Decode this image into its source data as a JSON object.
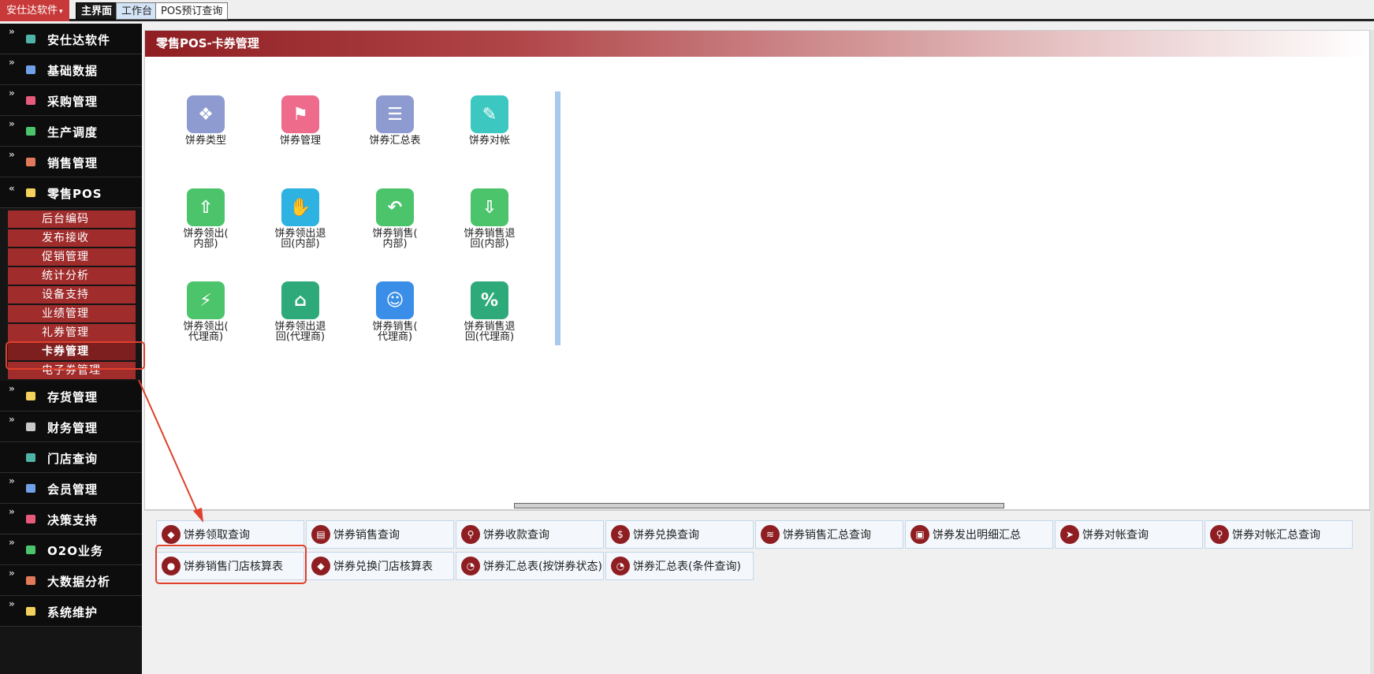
{
  "topbar": {
    "brand": "安仕达软件",
    "tabs": [
      "主界面",
      "工作台",
      "POS预订查询"
    ]
  },
  "sidebar": {
    "items_top": [
      {
        "label": "安仕达软件",
        "color": "#4fb3a8"
      },
      {
        "label": "基础数据",
        "color": "#6fa0e8"
      },
      {
        "label": "采购管理",
        "color": "#e85a7a"
      },
      {
        "label": "生产调度",
        "color": "#4cc46b"
      },
      {
        "label": "销售管理",
        "color": "#e07a5a"
      },
      {
        "label": "零售POS",
        "color": "#f2d25c"
      }
    ],
    "pos_sub": [
      "后台编码",
      "发布接收",
      "促销管理",
      "统计分析",
      "设备支持",
      "业绩管理",
      "礼券管理",
      "卡券管理",
      "电子券管理"
    ],
    "items_bottom": [
      {
        "label": "存货管理",
        "color": "#f2d25c"
      },
      {
        "label": "财务管理",
        "color": "#c9c9c9"
      },
      {
        "label": "门店查询",
        "color": "#4fb3a8"
      },
      {
        "label": "会员管理",
        "color": "#6fa0e8"
      },
      {
        "label": "决策支持",
        "color": "#e85a7a"
      },
      {
        "label": "O2O业务",
        "color": "#4cc46b"
      },
      {
        "label": "大数据分析",
        "color": "#e07a5a"
      },
      {
        "label": "系统维护",
        "color": "#f2d25c"
      }
    ]
  },
  "main": {
    "title": "零售POS-卡券管理",
    "icons": [
      {
        "l1": "饼券类型",
        "l2": "",
        "color": "#8e9bd0",
        "glyph": "❖"
      },
      {
        "l1": "饼券管理",
        "l2": "",
        "color": "#ee6b8c",
        "glyph": "⚑"
      },
      {
        "l1": "饼券汇总表",
        "l2": "",
        "color": "#8e9bd0",
        "glyph": "☰"
      },
      {
        "l1": "饼券对帐",
        "l2": "",
        "color": "#3cc8c0",
        "glyph": "✎"
      },
      {
        "l1": "饼券领出(",
        "l2": "内部)",
        "color": "#4cc46b",
        "glyph": "⇧"
      },
      {
        "l1": "饼券领出退",
        "l2": "回(内部)",
        "color": "#2eb2e2",
        "glyph": "✋"
      },
      {
        "l1": "饼券销售(",
        "l2": "内部)",
        "color": "#4cc46b",
        "glyph": "↶"
      },
      {
        "l1": "饼券销售退",
        "l2": "回(内部)",
        "color": "#4cc46b",
        "glyph": "⇩"
      },
      {
        "l1": "饼券领出(",
        "l2": "代理商)",
        "color": "#4cc46b",
        "glyph": "⚡"
      },
      {
        "l1": "饼券领出退",
        "l2": "回(代理商)",
        "color": "#2eaa7a",
        "glyph": "⌂"
      },
      {
        "l1": "饼券销售(",
        "l2": "代理商)",
        "color": "#3a8ee8",
        "glyph": "☺"
      },
      {
        "l1": "饼券销售退",
        "l2": "回(代理商)",
        "color": "#2eaa7a",
        "glyph": "%"
      }
    ]
  },
  "queries": [
    {
      "label": "饼券领取查询",
      "glyph": "◆"
    },
    {
      "label": "饼券销售查询",
      "glyph": "▤"
    },
    {
      "label": "饼券收款查询",
      "glyph": "⚲"
    },
    {
      "label": "饼券兑换查询",
      "glyph": "$"
    },
    {
      "label": "饼券销售汇总查询",
      "glyph": "≋"
    },
    {
      "label": "饼券发出明细汇总",
      "glyph": "▣"
    },
    {
      "label": "饼券对帐查询",
      "glyph": "➤"
    },
    {
      "label": "饼券对帐汇总查询",
      "glyph": "⚲"
    },
    {
      "label": "饼券销售门店核算表",
      "glyph": "●"
    },
    {
      "label": "饼券兑换门店核算表",
      "glyph": "◆"
    },
    {
      "label": "饼券汇总表(按饼券状态)",
      "glyph": "◔"
    },
    {
      "label": "饼券汇总表(条件查询)",
      "glyph": "◔"
    }
  ]
}
